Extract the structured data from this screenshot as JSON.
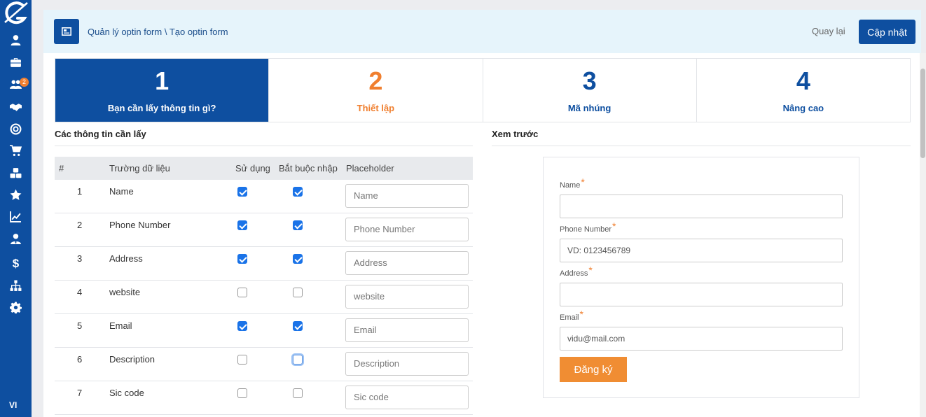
{
  "sidebar": {
    "badge_count": "2",
    "language": "VI",
    "items": [
      "user-icon",
      "briefcase-icon",
      "users-icon",
      "handshake-icon",
      "target-icon",
      "cart-icon",
      "cubes-icon",
      "star-icon",
      "chart-line-icon",
      "user-tie-icon",
      "dollar-icon",
      "sitemap-icon",
      "gear-icon"
    ]
  },
  "header": {
    "breadcrumb": "Quản lý optin form \\ Tạo optin form",
    "back_label": "Quay lại",
    "update_label": "Cập nhật"
  },
  "steps": [
    {
      "number": "1",
      "label": "Bạn cần lấy thông tin gì?",
      "state": "active"
    },
    {
      "number": "2",
      "label": "Thiết lập",
      "state": "current"
    },
    {
      "number": "3",
      "label": "Mã nhúng",
      "state": "default"
    },
    {
      "number": "4",
      "label": "Nâng cao",
      "state": "default"
    }
  ],
  "fields_section": {
    "title": "Các thông tin cần lấy",
    "columns": {
      "index": "#",
      "field": "Trường dữ liệu",
      "use": "Sử dụng",
      "required": "Bắt buộc nhập",
      "placeholder": "Placeholder"
    },
    "rows": [
      {
        "index": "1",
        "field": "Name",
        "use": true,
        "required": true,
        "placeholder": "Name"
      },
      {
        "index": "2",
        "field": "Phone Number",
        "use": true,
        "required": true,
        "placeholder": "Phone Number"
      },
      {
        "index": "3",
        "field": "Address",
        "use": true,
        "required": true,
        "placeholder": "Address"
      },
      {
        "index": "4",
        "field": "website",
        "use": false,
        "required": false,
        "placeholder": "website"
      },
      {
        "index": "5",
        "field": "Email",
        "use": true,
        "required": true,
        "placeholder": "Email"
      },
      {
        "index": "6",
        "field": "Description",
        "use": false,
        "required": false,
        "placeholder": "Description"
      },
      {
        "index": "7",
        "field": "Sic code",
        "use": false,
        "required": false,
        "placeholder": "Sic code"
      }
    ]
  },
  "preview": {
    "title": "Xem trước",
    "fields": [
      {
        "label": "Name",
        "required_mark": "*",
        "value": ""
      },
      {
        "label": "Phone Number",
        "required_mark": "*",
        "value": "VD: 0123456789"
      },
      {
        "label": "Address",
        "required_mark": "*",
        "value": ""
      },
      {
        "label": "Email",
        "required_mark": "*",
        "value": "vidu@mail.com"
      }
    ],
    "submit_label": "Đăng ký"
  },
  "colors": {
    "primary": "#0e4fa0",
    "accent": "#f07f2f",
    "header_bg": "#e6f4fb",
    "checkbox": "#1a73e8"
  }
}
